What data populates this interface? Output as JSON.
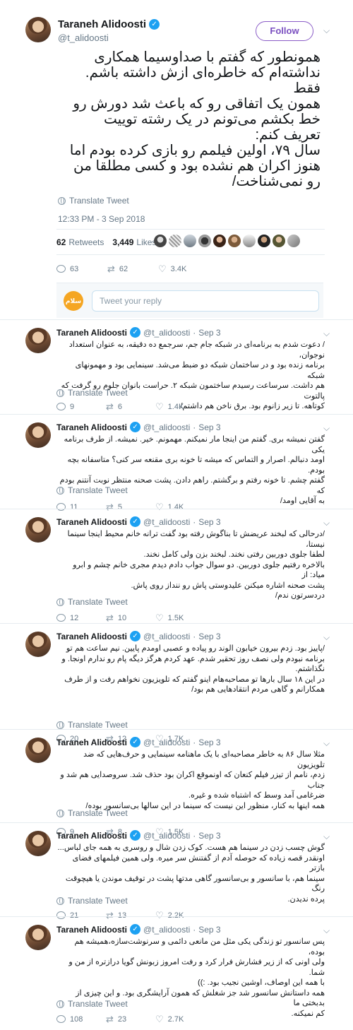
{
  "main_tweet": {
    "author_name": "Taraneh Alidoosti",
    "handle": "@t_alidoosti",
    "follow_label": "Follow",
    "body_lines": [
      "همونطور که گفتم با صداوسیما همکاری",
      "نداشته‌ام که خاطره‌ای ازش داشته باشم. فقط",
      "همون یک اتفاقی رو که باعث شد دورش رو",
      "خط بکشم می‌تونم در یک رشته توییت",
      "تعریف کنم:",
      "سال ۷۹، اولین فیلمم رو بازی کرده بودم اما",
      "هنوز اکران هم نشده بود و کسی مطلقا من",
      "رو نمی‌شناخت/"
    ],
    "translate_label": "Translate Tweet",
    "timestamp": "12:33 PM - 3 Sep 2018",
    "retweets_count": "62",
    "retweets_label": "Retweets",
    "likes_count": "3,449",
    "likes_label": "Likes",
    "replies": "63",
    "retweets": "62",
    "likes": "3.4K"
  },
  "reply_box": {
    "placeholder": "Tweet your reply",
    "avatar_text": "سلام"
  },
  "thread": [
    {
      "author_name": "Taraneh Alidoosti",
      "handle": "@t_alidoosti",
      "date": "Sep 3",
      "lines": [
        "/ دعوت شدم به برنامه‌ای در شبکه جام جم، سرجمع ده دقیقه، به عنوان استعداد نوجوان،",
        "برنامه زنده بود و در ساختمان شبکه دو ضبط می‌شد. سینمایی بود و مهمونهای شبکه",
        "هم داشت. سرساعت رسیدم ساختمون شبکه ۲. حراست بانوان جلوم رو گرفت که پالتوت",
        "کوتاهه. تا زیر زانوم بود. برق ناخن هم داشتم/"
      ],
      "translate_label": "Translate Tweet",
      "replies": "9",
      "retweets": "6",
      "likes": "1.4K"
    },
    {
      "author_name": "Taraneh Alidoosti",
      "handle": "@t_alidoosti",
      "date": "Sep 3",
      "lines": [
        "گفتن نمیشه بری. گفتم من اینجا مار نمیکنم. مهمونم. خیر. نمیشه. از طرف برنامه یکی",
        "اومد دنبالم. اصرار و التماس که میشه تا خونه بری مقنعه سر کنی؟ متاسفانه بچه بودم.",
        "گفتم چشم. تا خونه رفتم و برگشتم. راهم دادن. پشت صحنه منتظر نوبت آنتنم بودم که",
        "به آقایی اومد/"
      ],
      "translate_label": "Translate Tweet",
      "replies": "11",
      "retweets": "5",
      "likes": "1.4K"
    },
    {
      "author_name": "Taraneh Alidoosti",
      "handle": "@t_alidoosti",
      "date": "Sep 3",
      "lines": [
        "/درحالی که لبخند عریضش تا بناگوش رفته بود گفت ترانه خانم محیط اینجا سینما نیستا،",
        "لطفا جلوی دوربین رفتی نخند. لبخند بزن ولی کامل نخند.",
        "بالاخره رفتیم جلوی دوربین. دو سوال جواب دادم دیدم مجری خانم چشم و ابرو میاد: از",
        "پشت صحنه اشاره میکنن علیدوستی پاش رو ننداز روی پاش.",
        "دردسرتون ندم/"
      ],
      "translate_label": "Translate Tweet",
      "replies": "12",
      "retweets": "10",
      "likes": "1.5K"
    },
    {
      "author_name": "Taraneh Alidoosti",
      "handle": "@t_alidoosti",
      "date": "Sep 3",
      "lines": [
        "/پاییز بود. زدم بیرون خیابون الوند رو پیاده و عصبی اومدم پایین. نیم ساعت هم تو",
        "برنامه نبودم ولی نصف روز تحقیر شدم. عهد کردم هرگز دیگه پام رو ندارم اونجا. و",
        "نگذاشتم.",
        "در این ۱۸ سال بارها تو مصاحبه‌هام اینو گفتم که تلویزیون نخواهم رفت و از طرف",
        "همکارانم و گاهی مردم انتقادهایی هم بود/"
      ],
      "translate_label": "Translate Tweet",
      "replies": "20",
      "retweets": "12",
      "likes": "1.7K"
    },
    {
      "author_name": "Taraneh Alidoosti",
      "handle": "@t_alidoosti",
      "date": "Sep 3",
      "lines": [
        "مثلا سال ۸۶ به خاطر مصاحبه‌ای با یک ماهنامه سینمایی و حرف‌هایی که ضد تلویزیون",
        "زدم، نامم از تیزر فیلم کنعان که اونموقع اکران بود حذف شد. سروصدایی هم شد و جناب",
        "ضرغامی آمد وسط که اشتباه شده و غیره.",
        "همه اینها به کنار، منظور این نیست که سینما در این سالها بی‌سانسور بوده/"
      ],
      "translate_label": "Translate Tweet",
      "replies": "9",
      "retweets": "8",
      "likes": "1.5K"
    },
    {
      "author_name": "Taraneh Alidoosti",
      "handle": "@t_alidoosti",
      "date": "Sep 3",
      "lines": [
        "گوش چسب زدن در سینما هم هست. کوک زدن شال و روسری به همه جای لباس...",
        "اونقدر قصه زیاده که حوصله آدم از گفتنش سر میره. ولی همین فیلمهای فضای بازتر",
        "سینما هم، با سانسور و بی‌سانسور گاهی مدتها پشت در توقیف موندن یا هیچوقت رنگ",
        "پرده ندیدن."
      ],
      "translate_label": "Translate Tweet",
      "replies": "21",
      "retweets": "13",
      "likes": "2.2K"
    },
    {
      "author_name": "Taraneh Alidoosti",
      "handle": "@t_alidoosti",
      "date": "Sep 3",
      "lines": [
        "پس سانسور تو زندگی یکی مثل من مانعی دائمی و سرنوشت‌سازه،همیشه هم بوده،",
        "ولی اونی که از زیر فشارش فرار کرد و رفت امروز زبونش گویا درازتره از من و شما.",
        "با همه این اوصاف، اوشین نجیب بود. :))",
        "همه داستانش سانسور شد جز شغلش که همون آرایشگری بود. و این چیزی از بدبختی ما",
        "کم نمیکنه."
      ],
      "translate_label": "Translate Tweet",
      "replies": "108",
      "retweets": "23",
      "likes": "2.7K"
    }
  ],
  "colors": {
    "accent": "#1da1f2",
    "follow_border": "#8a5cc7",
    "muted": "#657786",
    "divider": "#e6ecf0"
  }
}
